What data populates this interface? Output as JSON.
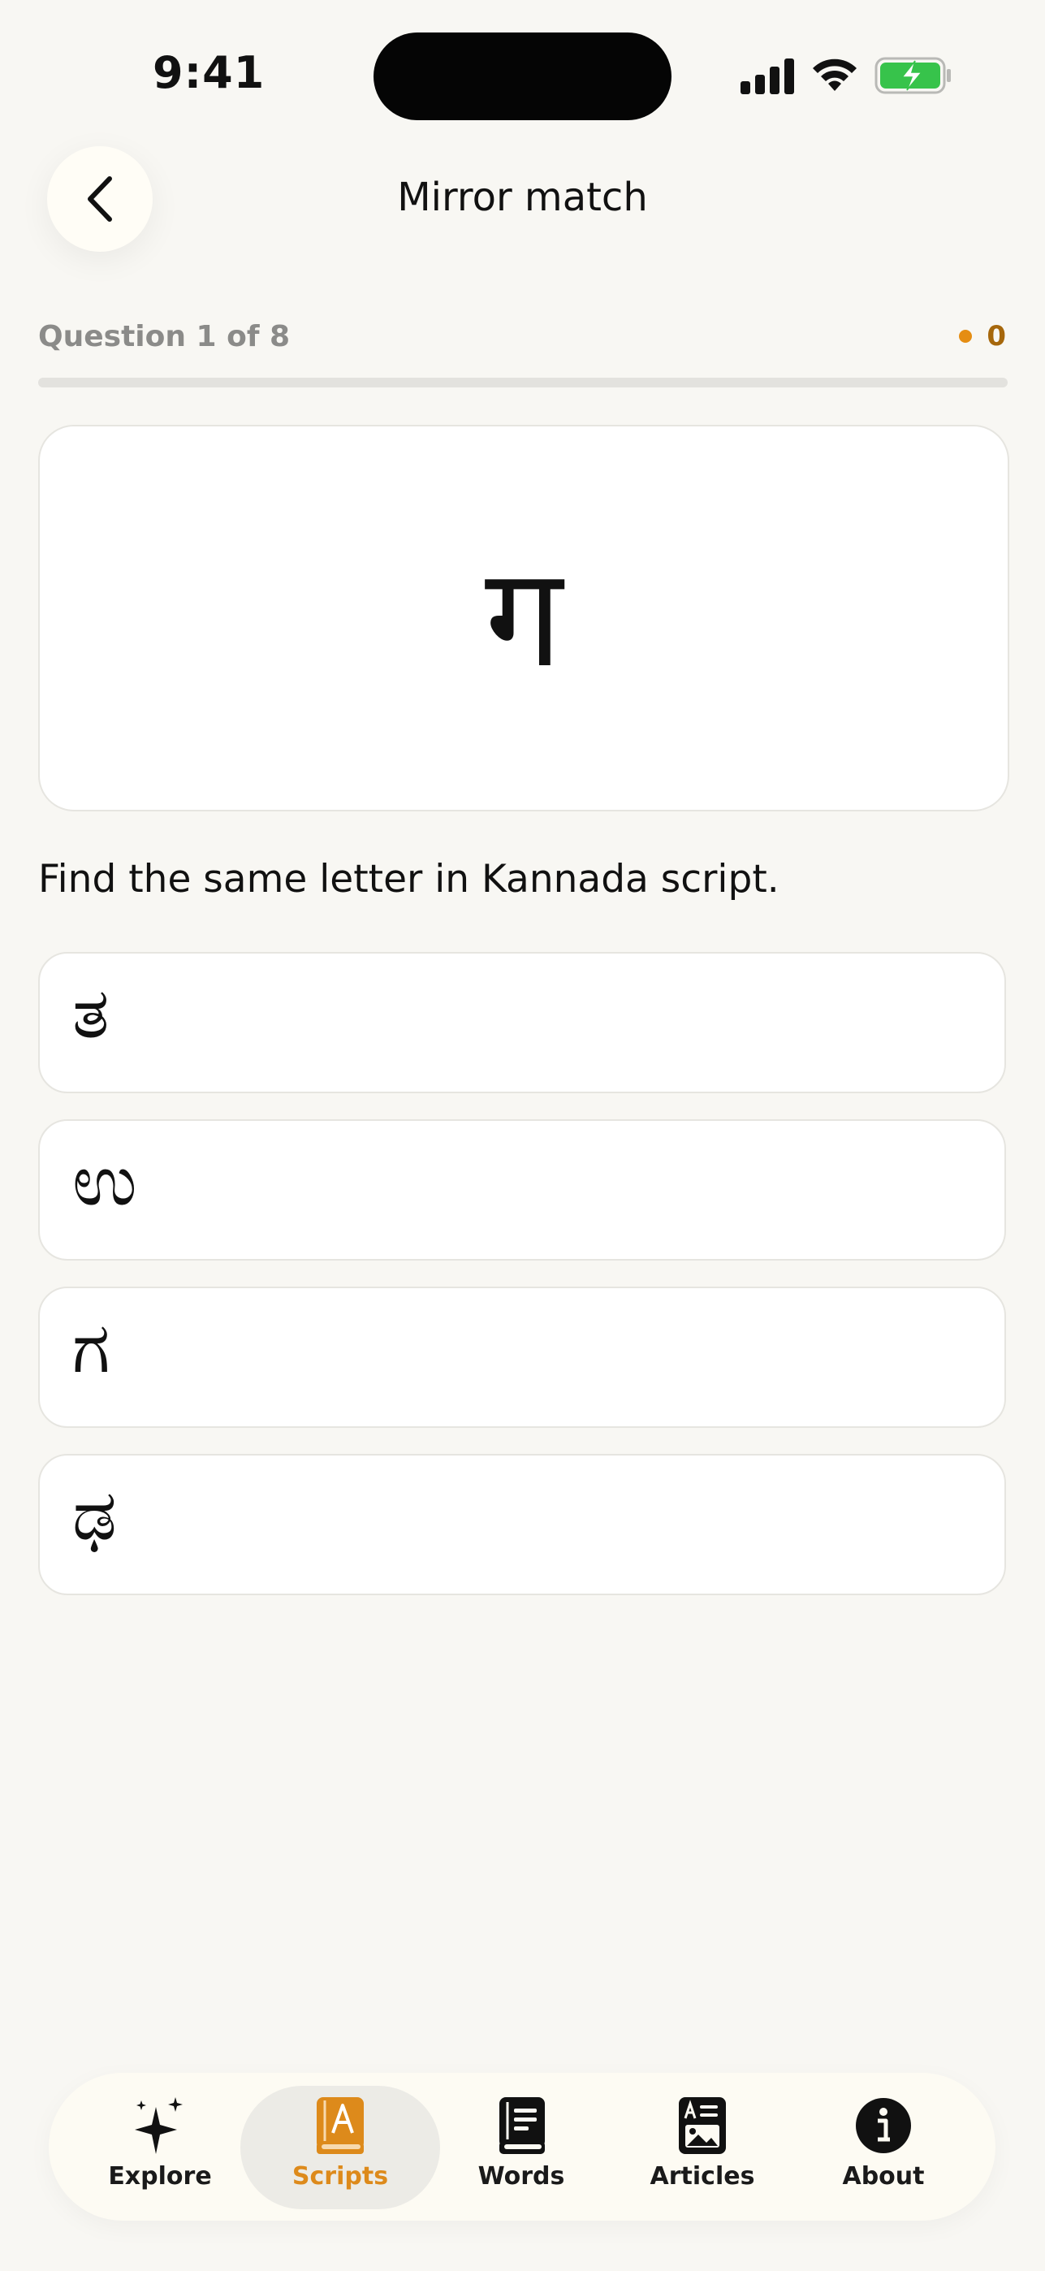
{
  "status_bar": {
    "time": "9:41"
  },
  "header": {
    "title": "Mirror match"
  },
  "progress": {
    "label": "Question 1 of 8",
    "score": "0",
    "fraction": 0
  },
  "question": {
    "prompt_letter": "ग",
    "instruction": "Find the same letter in Kannada script."
  },
  "options": [
    {
      "glyph": "ತ"
    },
    {
      "glyph": "ಉ"
    },
    {
      "glyph": "ಗ"
    },
    {
      "glyph": "ಢ"
    }
  ],
  "tabbar": {
    "tabs": [
      {
        "label": "Explore",
        "icon": "sparkle-icon"
      },
      {
        "label": "Scripts",
        "icon": "script-book-icon",
        "active": true
      },
      {
        "label": "Words",
        "icon": "book-icon"
      },
      {
        "label": "Articles",
        "icon": "article-icon"
      },
      {
        "label": "About",
        "icon": "info-icon"
      }
    ]
  },
  "colors": {
    "background": "#f8f7f3",
    "accent": "#dd8a1b",
    "score_text": "#a6670b",
    "battery_green": "#37c34b"
  }
}
